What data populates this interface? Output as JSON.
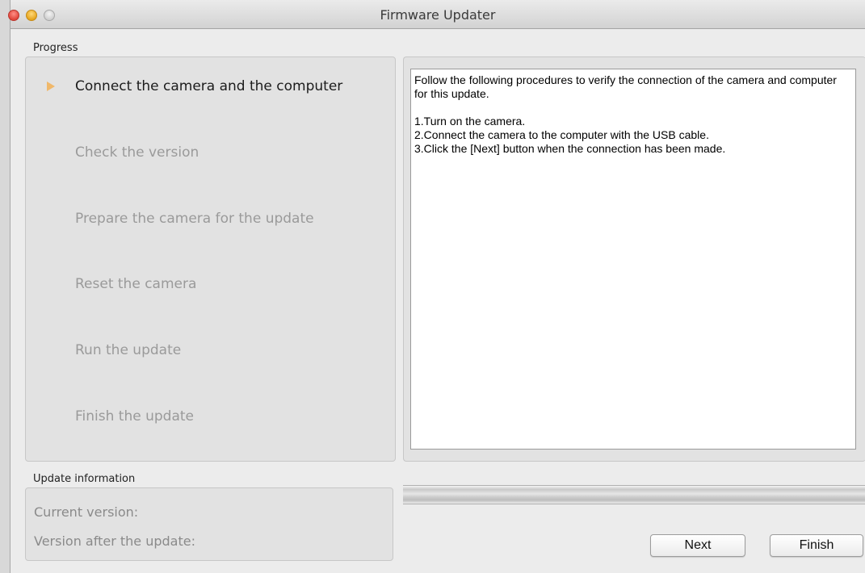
{
  "window": {
    "title": "Firmware Updater"
  },
  "progress": {
    "label": "Progress",
    "steps": [
      {
        "label": "Connect the camera and the computer",
        "active": true
      },
      {
        "label": "Check the version",
        "active": false
      },
      {
        "label": "Prepare the camera for the update",
        "active": false
      },
      {
        "label": "Reset the camera",
        "active": false
      },
      {
        "label": "Run the update",
        "active": false
      },
      {
        "label": "Finish the update",
        "active": false
      }
    ]
  },
  "instructions": {
    "intro": "Follow the following procedures to verify the connection of the camera and computer for this update.",
    "lines": [
      "1.Turn on the camera.",
      "2.Connect the camera to the computer with the USB cable.",
      "3.Click the [Next] button when the connection has been made."
    ]
  },
  "update_info": {
    "label": "Update information",
    "current_version_label": "Current version:",
    "version_after_label": "Version after the update:"
  },
  "update_progress": {
    "percent": 0
  },
  "buttons": {
    "next": "Next",
    "finish": "Finish"
  },
  "colors": {
    "active_step_arrow": "#f0b86a",
    "inactive_step_text": "#9a9a9a"
  }
}
